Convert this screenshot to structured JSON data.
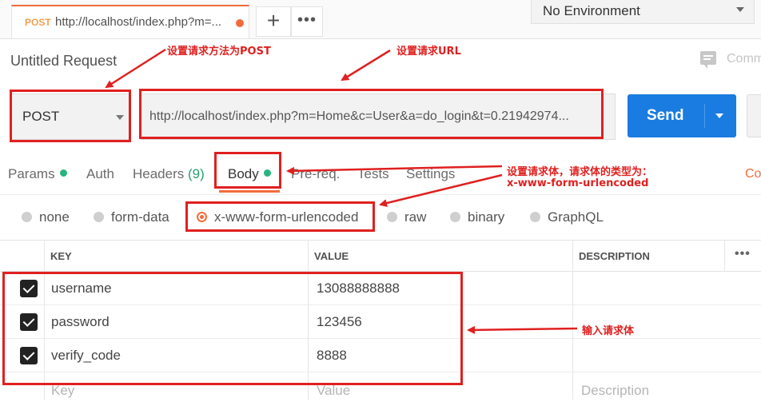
{
  "tab": {
    "method": "POST",
    "url": "http://localhost/index.php?m=..."
  },
  "new_tab": "+",
  "more": "•••",
  "environment": {
    "selected": "No Environment"
  },
  "request": {
    "title": "Untitled Request",
    "comments_label": "Comm"
  },
  "method": {
    "value": "POST"
  },
  "url": {
    "value": "http://localhost/index.php?m=Home&c=User&a=do_login&t=0.21942974..."
  },
  "send": {
    "label": "Send"
  },
  "request_tabs": {
    "params": "Params",
    "auth": "Auth",
    "headers": "Headers",
    "headers_count": "(9)",
    "body": "Body",
    "prereq": "Pre-req.",
    "tests": "Tests",
    "settings": "Settings",
    "cookies_edge": "Co"
  },
  "body_types": {
    "none": "none",
    "form_data": "form-data",
    "urlencoded": "x-www-form-urlencoded",
    "raw": "raw",
    "binary": "binary",
    "graphql": "GraphQL",
    "selected": "x-www-form-urlencoded"
  },
  "table": {
    "headers": {
      "key": "KEY",
      "value": "VALUE",
      "description": "DESCRIPTION"
    },
    "menu": "•••",
    "rows": [
      {
        "key": "username",
        "value": "13088888888",
        "checked": true
      },
      {
        "key": "password",
        "value": "123456",
        "checked": true
      },
      {
        "key": "verify_code",
        "value": "8888",
        "checked": true
      }
    ],
    "placeholder": {
      "key": "Key",
      "value": "Value",
      "description": "Description"
    }
  },
  "annotations": {
    "method": "设置请求方法为POST",
    "url": "设置请求URL",
    "body_line1": "设置请求体，请求体的类型为：",
    "body_line2": "x-www-form-urlencoded",
    "input": "输入请求体"
  },
  "colors": {
    "accent": "#f26b3a",
    "send": "#1a7ce0",
    "annotation": "#e02020",
    "active_dot": "#26b47f"
  }
}
